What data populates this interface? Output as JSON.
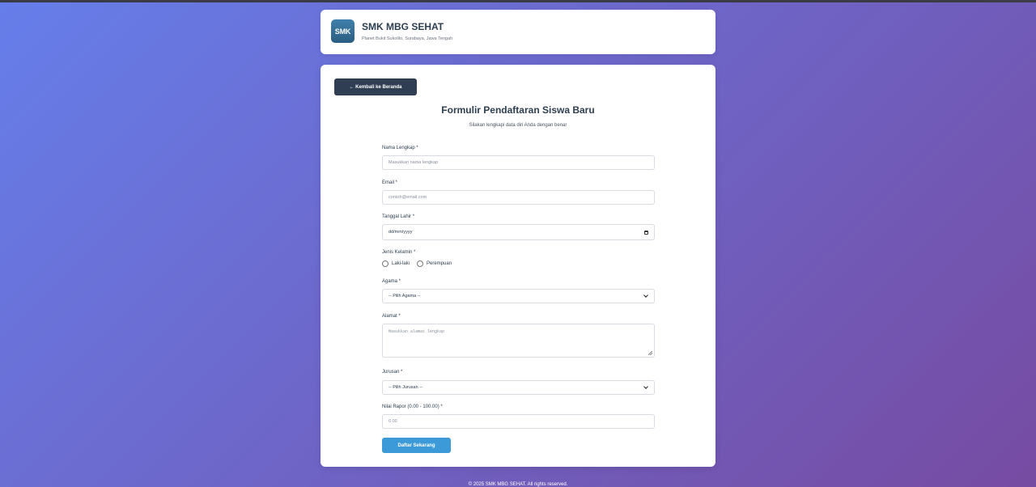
{
  "header": {
    "logo_text": "SMK",
    "school_name": "SMK MBG SEHAT",
    "address": "Planet Bukit Sukolilo, Surabaya, Jawa Tengah"
  },
  "form": {
    "back_button": "← Kembali ke Beranda",
    "title": "Formulir Pendaftaran Siswa Baru",
    "subtitle": "Silakan lengkapi data diri Anda dengan benar",
    "fields": {
      "nama": {
        "label": "Nama Lengkap *",
        "placeholder": "Masukkan nama lengkap"
      },
      "email": {
        "label": "Email *",
        "placeholder": "contoh@email.com"
      },
      "tanggal": {
        "label": "Tanggal Lahir *",
        "value": "dd/mm/yyyy"
      },
      "gender": {
        "label": "Jenis Kelamin *",
        "options": [
          "Laki-laki",
          "Perempuan"
        ]
      },
      "agama": {
        "label": "Agama *",
        "selected": "-- Pilih Agama --"
      },
      "alamat": {
        "label": "Alamat *",
        "placeholder": "Masukkan alamat lengkap"
      },
      "jurusan": {
        "label": "Jurusan *",
        "selected": "-- Pilih Jurusan --"
      },
      "nilai": {
        "label": "Nilai Rapor (0.00 - 100.00) *",
        "placeholder": "0.00"
      }
    },
    "submit_button": "Daftar Sekarang"
  },
  "footer": {
    "text": "© 2025 SMK MBG SEHAT. All rights reserved."
  },
  "colors": {
    "bg_gradient_start": "#667eea",
    "bg_gradient_end": "#764ba2",
    "back_button": "#2f3e52",
    "submit_button": "#3c9ad8"
  }
}
